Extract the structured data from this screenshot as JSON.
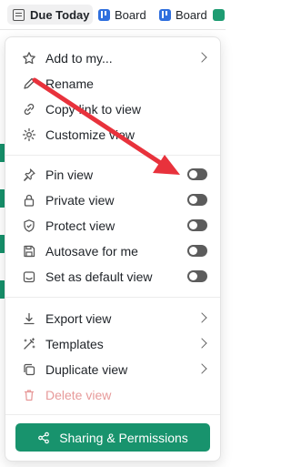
{
  "tabs": [
    {
      "label": "Due Today",
      "icon": "list-icon"
    },
    {
      "label": "Board",
      "icon": "board-icon"
    },
    {
      "label": "Board",
      "icon": "board-icon"
    }
  ],
  "menu": {
    "group1": [
      {
        "label": "Add to my...",
        "icon": "star-icon",
        "submenu": true
      },
      {
        "label": "Rename",
        "icon": "pencil-icon"
      },
      {
        "label": "Copy link to view",
        "icon": "link-icon"
      },
      {
        "label": "Customize view",
        "icon": "gear-icon"
      }
    ],
    "group2": [
      {
        "label": "Pin view",
        "icon": "pin-icon",
        "toggle": false
      },
      {
        "label": "Private view",
        "icon": "lock-icon",
        "toggle": false
      },
      {
        "label": "Protect view",
        "icon": "shield-icon",
        "toggle": false
      },
      {
        "label": "Autosave for me",
        "icon": "save-icon",
        "toggle": false
      },
      {
        "label": "Set as default view",
        "icon": "default-view-icon",
        "toggle": false
      }
    ],
    "group3": [
      {
        "label": "Export view",
        "icon": "export-icon",
        "submenu": true
      },
      {
        "label": "Templates",
        "icon": "templates-icon",
        "submenu": true
      },
      {
        "label": "Duplicate view",
        "icon": "duplicate-icon",
        "submenu": true
      },
      {
        "label": "Delete view",
        "icon": "trash-icon",
        "disabled": true
      }
    ],
    "share_button": "Sharing & Permissions"
  },
  "colors": {
    "accent": "#18936d",
    "annotation_arrow": "#e8323c",
    "toggle_off": "#5c5c5c",
    "delete_disabled": "#e79a9a"
  }
}
